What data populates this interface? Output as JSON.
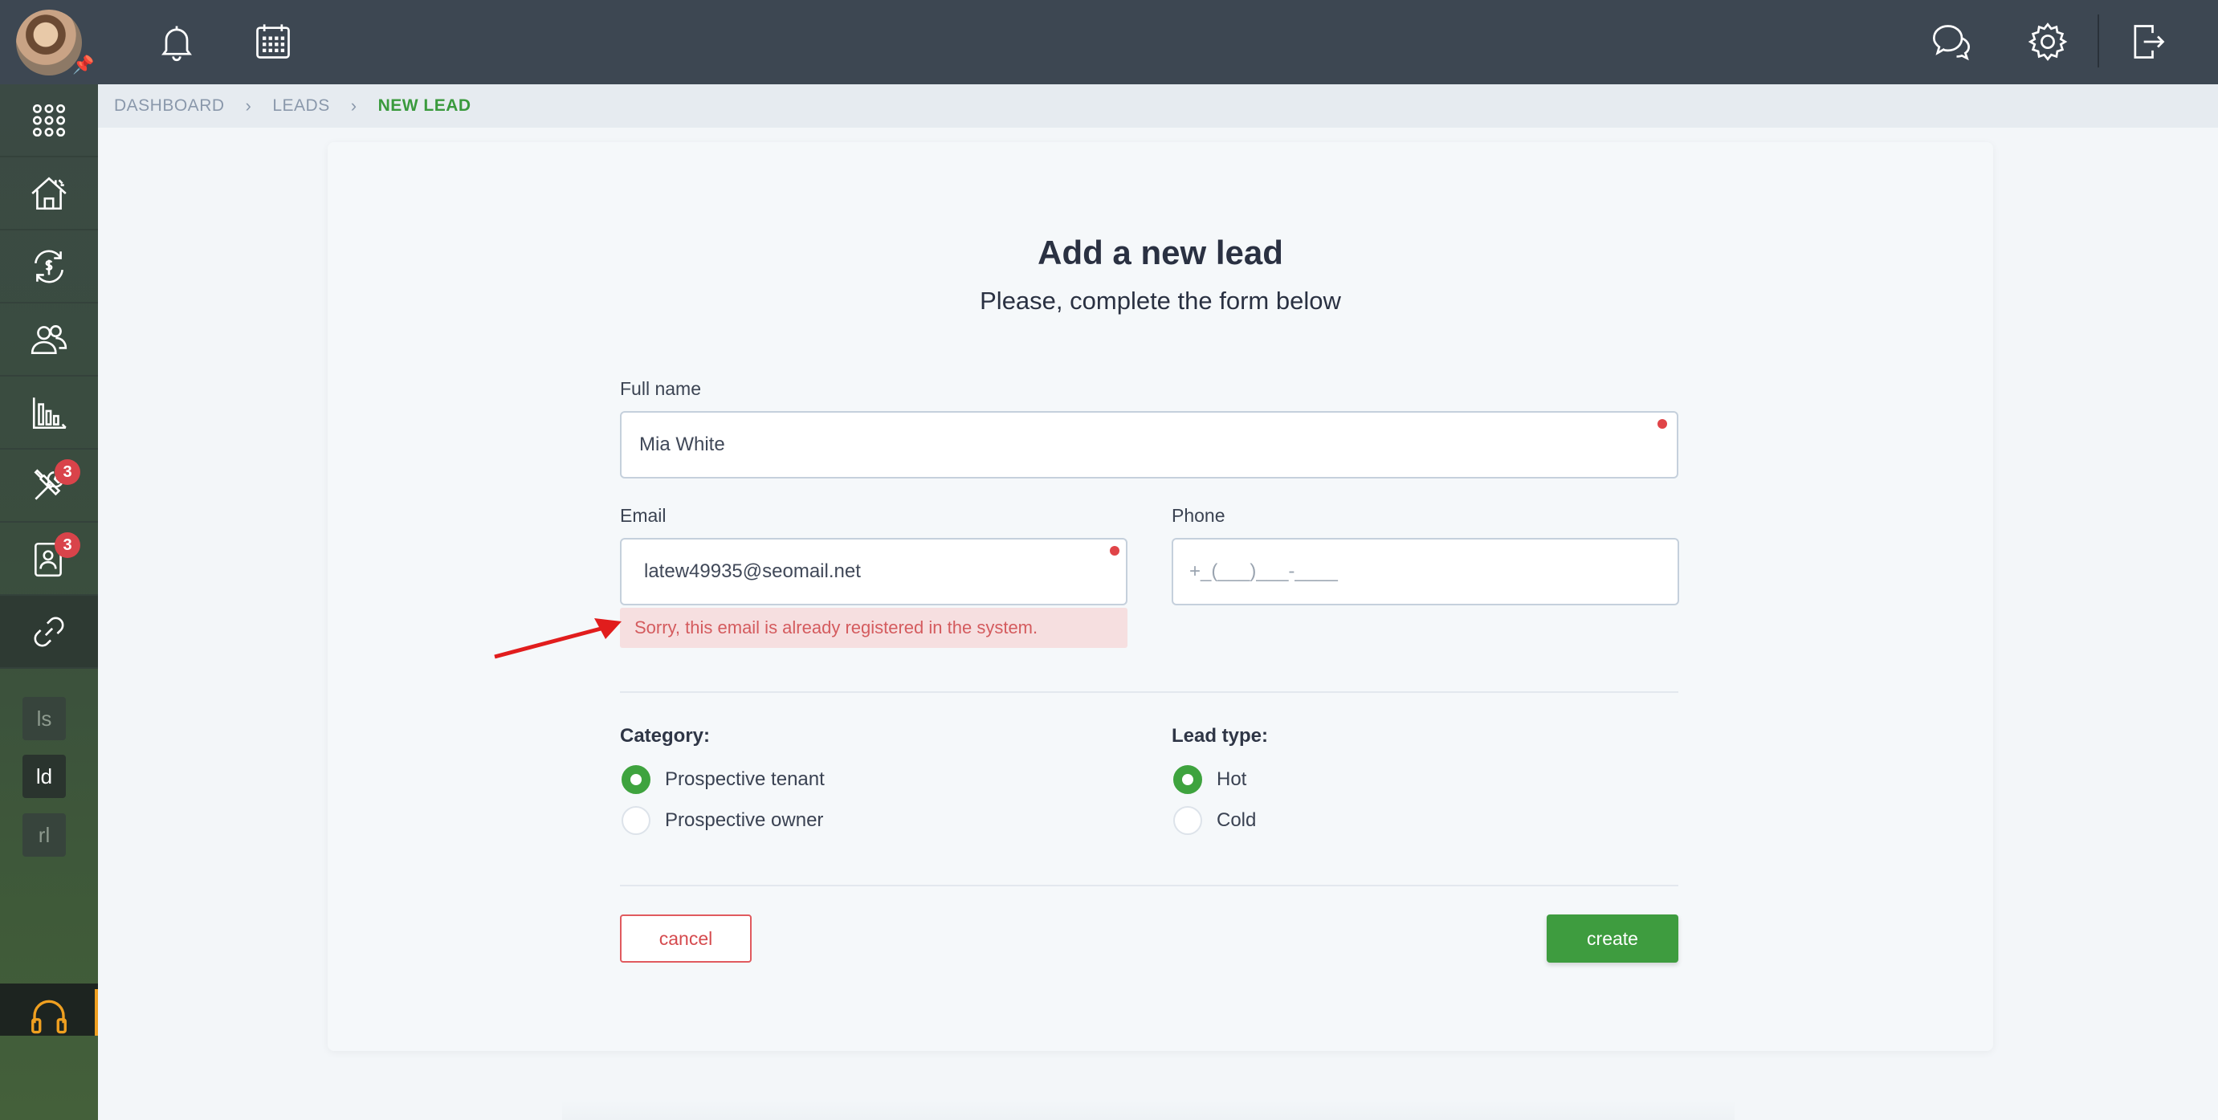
{
  "breadcrumb": {
    "items": [
      "DASHBOARD",
      "LEADS"
    ],
    "current": "NEW LEAD",
    "separator": "›"
  },
  "sidebar": {
    "badges": {
      "tools": "3",
      "documents": "3"
    },
    "mini_items": [
      "ls",
      "ld",
      "rl"
    ]
  },
  "form": {
    "title": "Add a new lead",
    "subtitle": "Please, complete the form below",
    "full_name": {
      "label": "Full name",
      "value": "Mia White"
    },
    "email": {
      "label": "Email",
      "value": "latew49935@seomail.net",
      "error": "Sorry, this email is already registered in the system."
    },
    "phone": {
      "label": "Phone",
      "placeholder": "+_(___)___-____"
    },
    "category": {
      "label": "Category:",
      "options": [
        "Prospective tenant",
        "Prospective owner"
      ],
      "selected": "Prospective tenant"
    },
    "lead_type": {
      "label": "Lead type:",
      "options": [
        "Hot",
        "Cold"
      ],
      "selected": "Hot"
    },
    "cancel_label": "cancel",
    "create_label": "create"
  },
  "colors": {
    "accent_green": "#3e9c3f",
    "error_red": "#e04448",
    "topbar": "#3d4752"
  },
  "icons": [
    "bell-icon",
    "calendar-icon",
    "chat-icon",
    "gear-icon",
    "logout-icon",
    "apps-grid-icon",
    "house-icon",
    "money-cycle-icon",
    "people-icon",
    "chart-icon",
    "tools-icon",
    "document-user-icon",
    "link-icon",
    "headset-icon"
  ]
}
